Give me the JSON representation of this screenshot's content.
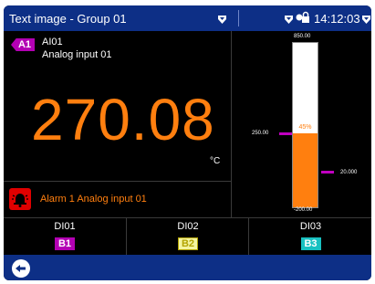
{
  "header": {
    "title": "Text image - Group 01",
    "time": "14:12:03"
  },
  "channel": {
    "tag": "A1",
    "id": "AI01",
    "name": "Analog input 01",
    "value": "270.08",
    "unit": "°C"
  },
  "alarm": {
    "text": "Alarm 1 Analog input 01"
  },
  "bargraph": {
    "scale_max": "850.00",
    "scale_min": "-200.00",
    "percent_label": "45%",
    "fill_fraction": 0.45,
    "limit_low": "250.00",
    "limit_high": "20.000"
  },
  "digital_inputs": [
    {
      "name": "DI01",
      "badge": "B1"
    },
    {
      "name": "DI02",
      "badge": "B2"
    },
    {
      "name": "DI03",
      "badge": "B3"
    }
  ],
  "colors": {
    "header_bg": "#0d2f86",
    "value_orange": "#ff7f0f",
    "alarm_red": "#e00000",
    "badge_purple": "#b300b3",
    "badge_yellow": "#f4f4a0",
    "badge_cyan": "#19c1c1"
  },
  "icons": {
    "group_dropdown": "chevron-down-icon",
    "lock": "lock-icon",
    "alarm": "alarm-bell-icon",
    "back": "back-arrow-icon"
  }
}
